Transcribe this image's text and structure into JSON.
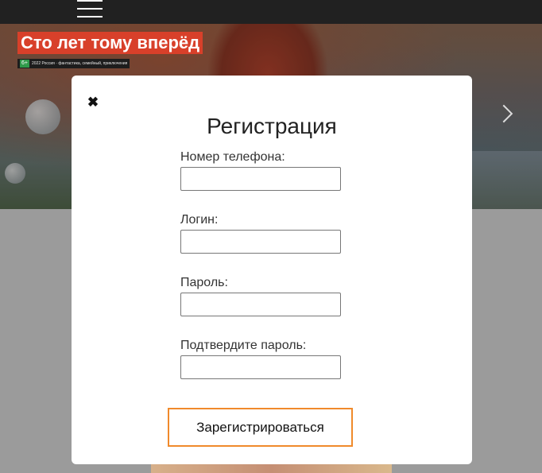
{
  "header": {
    "menu_icon": "hamburger-menu-icon"
  },
  "hero": {
    "title": "Сто лет тому вперёд",
    "badge_rating": "6+",
    "badge_meta": "2022 Россия · фантастика, семейный, приключения",
    "next_icon": "chevron-right-icon"
  },
  "modal": {
    "close_icon": "close-icon",
    "close_glyph": "✖",
    "title": "Регистрация",
    "fields": [
      {
        "label": "Номер телефона:",
        "value": "",
        "placeholder": ""
      },
      {
        "label": "Логин:",
        "value": "",
        "placeholder": ""
      },
      {
        "label": "Пароль:",
        "value": "",
        "placeholder": ""
      },
      {
        "label": "Подтвердите пароль:",
        "value": "",
        "placeholder": ""
      }
    ],
    "submit_label": "Зарегистрироваться"
  },
  "colors": {
    "topbar": "#212121",
    "accent_button_border": "#f08a2b",
    "hero_title_bg": "#d8402a",
    "page_backdrop": "#9b9b9b"
  }
}
